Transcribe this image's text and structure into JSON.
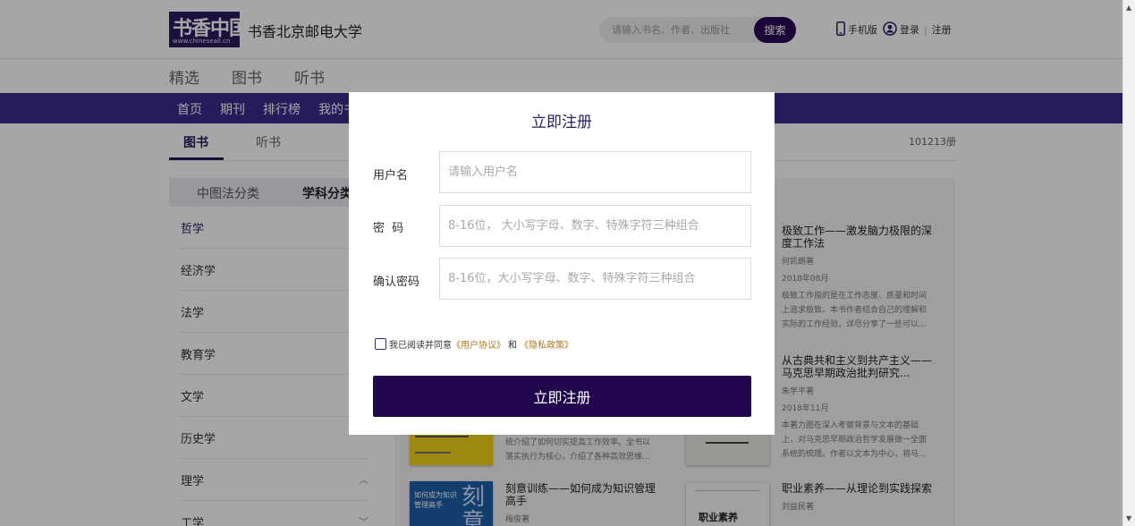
{
  "header": {
    "logo_text": "书香中国",
    "logo_url": "www.chineseall.cn",
    "site_name": "书香北京邮电大学",
    "search_placeholder": "请输入书名、作者、出版社",
    "search_button": "搜索",
    "mobile_label": "手机版",
    "login_label": "登录",
    "register_label": "注册"
  },
  "subnav": [
    "精选",
    "图书",
    "听书"
  ],
  "mainnav": [
    "首页",
    "期刊",
    "排行榜",
    "我的书"
  ],
  "tabs": {
    "items": [
      "图书",
      "听书"
    ],
    "count": "101213册"
  },
  "classification": {
    "tabs": [
      "中图法分类",
      "学科分类"
    ]
  },
  "categories": [
    "哲学",
    "经济学",
    "法学",
    "教育学",
    "文学",
    "历史学",
    "理学",
    "工学"
  ],
  "books": [
    {
      "title": "极致工作——激发脑力极限的深度工作法",
      "author": "何凯朗著",
      "date": "2018年08月",
      "desc": "极致工作指的是在工作态度、质量和时间上追求极致。本书作者结合自己的理解和实际的工作经验，详尽分享了一些可以..."
    },
    {
      "title": "从古典共和主义到共产主义——马克思早期政治批判研究...",
      "author": "朱学平著",
      "date": "2018年11月",
      "desc": "本著力图在深入考察背景与文本的基础上，对马克思早期政治哲学发展做一全面系统的梳理。作者以文本为中心，将马..."
    },
    {
      "title": "",
      "author": "",
      "date": "",
      "desc": "统介绍了如何切实提高工作效率。全书以落实执行为核心，介绍了各种高效思维..."
    },
    {
      "title": "刻意训练——如何成为知识管理高手",
      "author": "梅俊著",
      "date": "",
      "desc": ""
    },
    {
      "title": "职业素养——从理论到实践探索",
      "author": "刘益民著",
      "date": "",
      "desc": ""
    }
  ],
  "covers": {
    "c3_text": "如何成为知识管理高手",
    "c3_big": "刻意",
    "c4_text": "职业素养"
  },
  "modal": {
    "title": "立即注册",
    "username_label": "用户名",
    "username_placeholder": "请输入用户名",
    "password_label": "密  码",
    "password_placeholder": "8-16位， 大小写字母、数字、特殊字符三种组合",
    "confirm_label": "确认密码",
    "confirm_placeholder": "8-16位，大小写字母、数字、特殊字符三种组合",
    "agree_prefix": "我已阅读并同意",
    "user_agreement": "《用户协议》",
    "agree_and": "和",
    "privacy_policy": "《隐私政策》",
    "submit_label": "立即注册"
  },
  "colors": {
    "brand_purple": "#2b1b5e",
    "nav_purple": "#3b2a8c",
    "submit_purple": "#22064d",
    "link_gold": "#b07820"
  }
}
